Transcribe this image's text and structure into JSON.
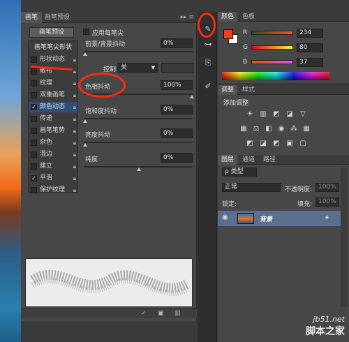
{
  "brush_panel": {
    "tabs": [
      "画笔",
      "画笔预设"
    ],
    "preset_button": "画笔预设",
    "apply_each_tip": "应用每笔尖",
    "list_header": "画笔笔尖形状",
    "items": [
      {
        "label": "形状动态",
        "checked": false
      },
      {
        "label": "散布",
        "checked": false
      },
      {
        "label": "纹理",
        "checked": false
      },
      {
        "label": "双重画笔",
        "checked": false
      },
      {
        "label": "颜色动态",
        "checked": true
      },
      {
        "label": "传递",
        "checked": false
      },
      {
        "label": "画笔笔势",
        "checked": false
      },
      {
        "label": "杂色",
        "checked": false
      },
      {
        "label": "湿边",
        "checked": false
      },
      {
        "label": "建立",
        "checked": false
      },
      {
        "label": "平滑",
        "checked": true
      },
      {
        "label": "保护纹理",
        "checked": false
      }
    ],
    "fg_bg_jitter_label": "前景/背景抖动",
    "fg_bg_jitter_value": "0%",
    "control_label": "控制:",
    "control_value": "关",
    "hue_jitter_label": "色相抖动",
    "hue_jitter_value": "100%",
    "saturation_jitter_label": "饱和度抖动",
    "saturation_jitter_value": "0%",
    "brightness_jitter_label": "亮度抖动",
    "brightness_jitter_value": "0%",
    "purity_label": "纯度",
    "purity_value": "0%"
  },
  "color_panel": {
    "tabs": [
      "颜色",
      "色板"
    ],
    "fg_color": "#e8431c",
    "channels": [
      {
        "label": "R",
        "value": "234"
      },
      {
        "label": "G",
        "value": "80"
      },
      {
        "label": "B",
        "value": "37"
      }
    ]
  },
  "adjust_panel": {
    "tabs": [
      "调整",
      "样式"
    ],
    "title": "添加调整"
  },
  "layers_panel": {
    "tabs": [
      "图层",
      "通道",
      "路径"
    ],
    "kind_label": "ρ 类型",
    "blend_mode": "正常",
    "opacity_label": "不透明度:",
    "opacity_value": "100%",
    "lock_label": "锁定:",
    "fill_label": "填充:",
    "fill_value": "100%",
    "layer_name": "背景"
  },
  "watermark": {
    "url": "jb51.net",
    "name": "脚本之家"
  }
}
